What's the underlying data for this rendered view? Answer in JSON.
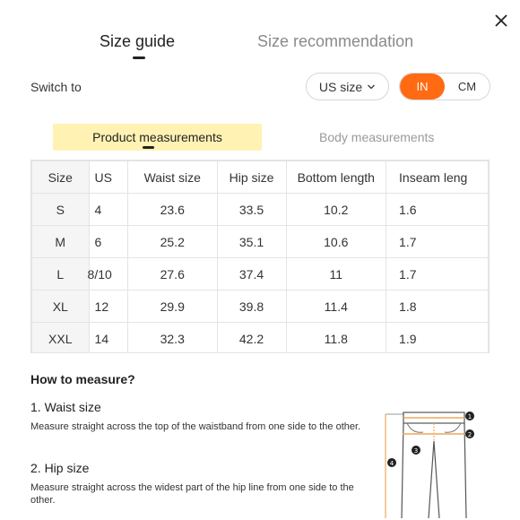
{
  "close_icon": "close-icon",
  "tabs": {
    "active": "Size guide",
    "inactive": "Size recommendation"
  },
  "switch": {
    "label": "Switch to",
    "region_select": "US size",
    "units": [
      "IN",
      "CM"
    ],
    "active_unit": "IN"
  },
  "measure_tabs": {
    "active": "Product measurements",
    "inactive": "Body measurements"
  },
  "table": {
    "headers": [
      "Size",
      "US",
      "Waist size",
      "Hip size",
      "Bottom length",
      "Inseam leng"
    ],
    "rows": [
      [
        "S",
        "4",
        "23.6",
        "33.5",
        "10.2",
        "1.6"
      ],
      [
        "M",
        "6",
        "25.2",
        "35.1",
        "10.6",
        "1.7"
      ],
      [
        "L",
        "8/10",
        "27.6",
        "37.4",
        "11",
        "1.7"
      ],
      [
        "XL",
        "12",
        "29.9",
        "39.8",
        "11.4",
        "1.8"
      ],
      [
        "XXL",
        "14",
        "32.3",
        "42.2",
        "11.8",
        "1.9"
      ]
    ]
  },
  "howto": {
    "title": "How to measure?",
    "sections": [
      {
        "title": "1. Waist size",
        "text": "Measure straight across the top of the waistband from one side to the other."
      },
      {
        "title": "2. Hip size",
        "text": "Measure straight across the widest part of the hip line from one side to the other."
      }
    ]
  },
  "figure_markers": [
    "1",
    "2",
    "3",
    "4"
  ],
  "colors": {
    "accent": "#ff6a13",
    "highlight": "#fff2b3",
    "marker": "#f2a65a"
  }
}
